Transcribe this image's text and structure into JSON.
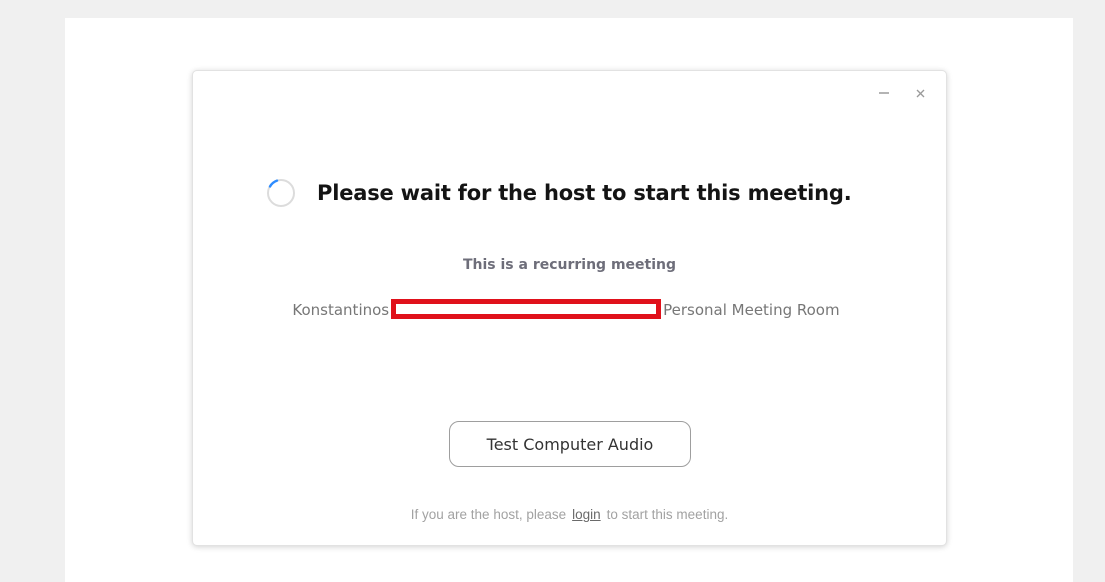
{
  "dialog": {
    "heading": "Please wait for the host to start this meeting.",
    "recurring_text": "This is a recurring meeting",
    "room": {
      "host_name": "Konstantinos",
      "room_suffix": "Personal Meeting Room"
    },
    "audio_button_label": "Test Computer Audio",
    "host_prompt": {
      "prefix": "If you are the host, please",
      "link_label": "login",
      "suffix": "to start this meeting."
    }
  },
  "icons": {
    "minimize": "minimize-icon",
    "close": "close-icon",
    "spinner": "loading-spinner-icon"
  },
  "colors": {
    "page_background": "#f0f0f0",
    "dialog_background": "#ffffff",
    "redaction_box": "#e0111b",
    "spinner_accent": "#2d8cff"
  }
}
